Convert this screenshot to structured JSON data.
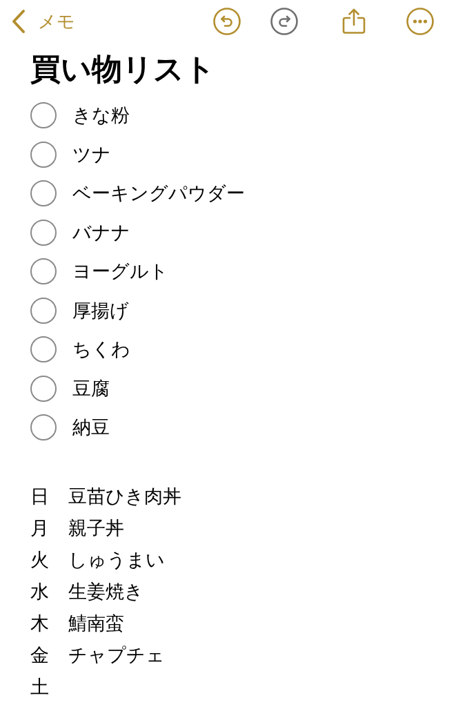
{
  "nav": {
    "back_label": "メモ",
    "actions": [
      {
        "kind": "undo",
        "disabled": false
      },
      {
        "kind": "redo",
        "disabled": true
      },
      {
        "kind": "share",
        "disabled": false
      },
      {
        "kind": "more",
        "disabled": false
      }
    ]
  },
  "note": {
    "title": "買い物リスト",
    "checklist": [
      {
        "text": "きな粉",
        "checked": false
      },
      {
        "text": "ツナ",
        "checked": false
      },
      {
        "text": "ベーキングパウダー",
        "checked": false
      },
      {
        "text": "バナナ",
        "checked": false
      },
      {
        "text": "ヨーグルト",
        "checked": false
      },
      {
        "text": "厚揚げ",
        "checked": false
      },
      {
        "text": "ちくわ",
        "checked": false
      },
      {
        "text": "豆腐",
        "checked": false
      },
      {
        "text": "納豆",
        "checked": false
      }
    ],
    "menu": [
      {
        "day": "日",
        "dish": "豆苗ひき肉丼"
      },
      {
        "day": "月",
        "dish": "親子丼"
      },
      {
        "day": "火",
        "dish": "しゅうまい"
      },
      {
        "day": "水",
        "dish": "生姜焼き"
      },
      {
        "day": "木",
        "dish": "鯖南蛮"
      },
      {
        "day": "金",
        "dish": "チャプチェ"
      },
      {
        "day": "土"
      }
    ]
  }
}
